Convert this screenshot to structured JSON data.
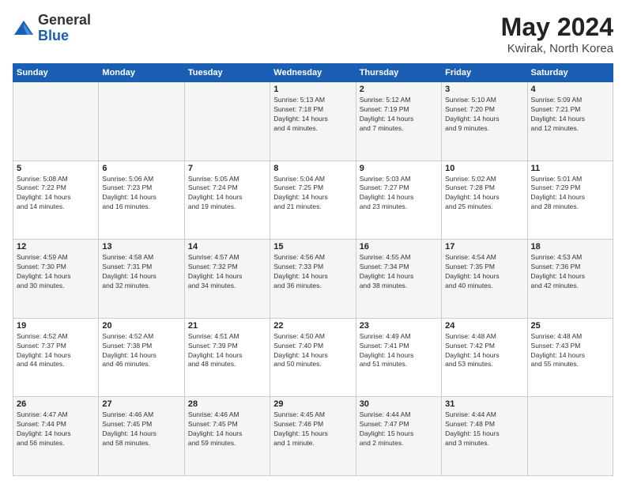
{
  "logo": {
    "general": "General",
    "blue": "Blue"
  },
  "header": {
    "month": "May 2024",
    "location": "Kwirak, North Korea"
  },
  "weekdays": [
    "Sunday",
    "Monday",
    "Tuesday",
    "Wednesday",
    "Thursday",
    "Friday",
    "Saturday"
  ],
  "weeks": [
    [
      {
        "day": "",
        "info": ""
      },
      {
        "day": "",
        "info": ""
      },
      {
        "day": "",
        "info": ""
      },
      {
        "day": "1",
        "info": "Sunrise: 5:13 AM\nSunset: 7:18 PM\nDaylight: 14 hours\nand 4 minutes."
      },
      {
        "day": "2",
        "info": "Sunrise: 5:12 AM\nSunset: 7:19 PM\nDaylight: 14 hours\nand 7 minutes."
      },
      {
        "day": "3",
        "info": "Sunrise: 5:10 AM\nSunset: 7:20 PM\nDaylight: 14 hours\nand 9 minutes."
      },
      {
        "day": "4",
        "info": "Sunrise: 5:09 AM\nSunset: 7:21 PM\nDaylight: 14 hours\nand 12 minutes."
      }
    ],
    [
      {
        "day": "5",
        "info": "Sunrise: 5:08 AM\nSunset: 7:22 PM\nDaylight: 14 hours\nand 14 minutes."
      },
      {
        "day": "6",
        "info": "Sunrise: 5:06 AM\nSunset: 7:23 PM\nDaylight: 14 hours\nand 16 minutes."
      },
      {
        "day": "7",
        "info": "Sunrise: 5:05 AM\nSunset: 7:24 PM\nDaylight: 14 hours\nand 19 minutes."
      },
      {
        "day": "8",
        "info": "Sunrise: 5:04 AM\nSunset: 7:25 PM\nDaylight: 14 hours\nand 21 minutes."
      },
      {
        "day": "9",
        "info": "Sunrise: 5:03 AM\nSunset: 7:27 PM\nDaylight: 14 hours\nand 23 minutes."
      },
      {
        "day": "10",
        "info": "Sunrise: 5:02 AM\nSunset: 7:28 PM\nDaylight: 14 hours\nand 25 minutes."
      },
      {
        "day": "11",
        "info": "Sunrise: 5:01 AM\nSunset: 7:29 PM\nDaylight: 14 hours\nand 28 minutes."
      }
    ],
    [
      {
        "day": "12",
        "info": "Sunrise: 4:59 AM\nSunset: 7:30 PM\nDaylight: 14 hours\nand 30 minutes."
      },
      {
        "day": "13",
        "info": "Sunrise: 4:58 AM\nSunset: 7:31 PM\nDaylight: 14 hours\nand 32 minutes."
      },
      {
        "day": "14",
        "info": "Sunrise: 4:57 AM\nSunset: 7:32 PM\nDaylight: 14 hours\nand 34 minutes."
      },
      {
        "day": "15",
        "info": "Sunrise: 4:56 AM\nSunset: 7:33 PM\nDaylight: 14 hours\nand 36 minutes."
      },
      {
        "day": "16",
        "info": "Sunrise: 4:55 AM\nSunset: 7:34 PM\nDaylight: 14 hours\nand 38 minutes."
      },
      {
        "day": "17",
        "info": "Sunrise: 4:54 AM\nSunset: 7:35 PM\nDaylight: 14 hours\nand 40 minutes."
      },
      {
        "day": "18",
        "info": "Sunrise: 4:53 AM\nSunset: 7:36 PM\nDaylight: 14 hours\nand 42 minutes."
      }
    ],
    [
      {
        "day": "19",
        "info": "Sunrise: 4:52 AM\nSunset: 7:37 PM\nDaylight: 14 hours\nand 44 minutes."
      },
      {
        "day": "20",
        "info": "Sunrise: 4:52 AM\nSunset: 7:38 PM\nDaylight: 14 hours\nand 46 minutes."
      },
      {
        "day": "21",
        "info": "Sunrise: 4:51 AM\nSunset: 7:39 PM\nDaylight: 14 hours\nand 48 minutes."
      },
      {
        "day": "22",
        "info": "Sunrise: 4:50 AM\nSunset: 7:40 PM\nDaylight: 14 hours\nand 50 minutes."
      },
      {
        "day": "23",
        "info": "Sunrise: 4:49 AM\nSunset: 7:41 PM\nDaylight: 14 hours\nand 51 minutes."
      },
      {
        "day": "24",
        "info": "Sunrise: 4:48 AM\nSunset: 7:42 PM\nDaylight: 14 hours\nand 53 minutes."
      },
      {
        "day": "25",
        "info": "Sunrise: 4:48 AM\nSunset: 7:43 PM\nDaylight: 14 hours\nand 55 minutes."
      }
    ],
    [
      {
        "day": "26",
        "info": "Sunrise: 4:47 AM\nSunset: 7:44 PM\nDaylight: 14 hours\nand 56 minutes."
      },
      {
        "day": "27",
        "info": "Sunrise: 4:46 AM\nSunset: 7:45 PM\nDaylight: 14 hours\nand 58 minutes."
      },
      {
        "day": "28",
        "info": "Sunrise: 4:46 AM\nSunset: 7:45 PM\nDaylight: 14 hours\nand 59 minutes."
      },
      {
        "day": "29",
        "info": "Sunrise: 4:45 AM\nSunset: 7:46 PM\nDaylight: 15 hours\nand 1 minute."
      },
      {
        "day": "30",
        "info": "Sunrise: 4:44 AM\nSunset: 7:47 PM\nDaylight: 15 hours\nand 2 minutes."
      },
      {
        "day": "31",
        "info": "Sunrise: 4:44 AM\nSunset: 7:48 PM\nDaylight: 15 hours\nand 3 minutes."
      },
      {
        "day": "",
        "info": ""
      }
    ]
  ]
}
